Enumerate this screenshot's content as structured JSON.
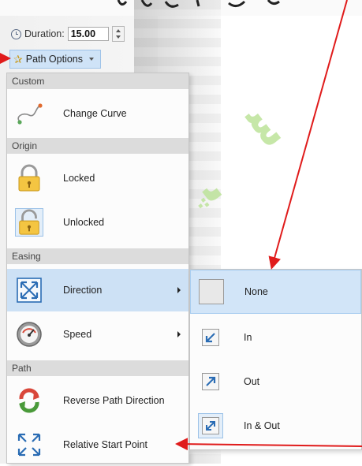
{
  "header": {
    "duration_label": "Duration:",
    "duration_value": "15.00",
    "path_options_label": "Path Options"
  },
  "menu": {
    "sections": {
      "custom": "Custom",
      "origin": "Origin",
      "easing": "Easing",
      "path": "Path"
    },
    "items": {
      "change_curve": "Change Curve",
      "locked": "Locked",
      "unlocked": "Unlocked",
      "direction": "Direction",
      "speed": "Speed",
      "reverse_path": "Reverse Path Direction",
      "relative_start": "Relative Start Point"
    }
  },
  "submenu": {
    "items": [
      "None",
      "In",
      "Out",
      "In & Out"
    ],
    "selected": "None"
  },
  "icons": {
    "duration": "clock-icon",
    "path_options": "star-path-icon",
    "change_curve": "curve-icon",
    "locked": "padlock-closed-icon",
    "unlocked": "padlock-open-icon",
    "direction": "expand-arrows-icon",
    "speed": "speedometer-icon",
    "reverse_path": "reverse-arrows-icon",
    "relative_start": "relative-start-icon",
    "in": "arrow-in-icon",
    "out": "arrow-out-icon",
    "in_out": "arrow-in-out-icon"
  },
  "colors": {
    "annotation_arrow": "#e01b1b",
    "highlight": "#cde1f5",
    "section_bg": "#dcdcdc",
    "icon_blue": "#2a6cb4"
  }
}
